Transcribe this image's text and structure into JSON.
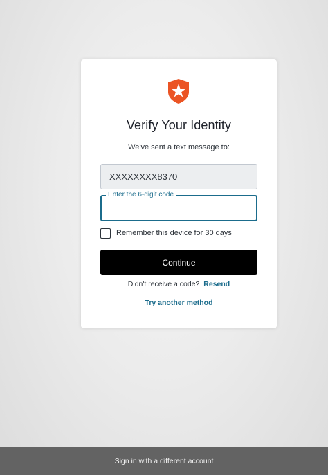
{
  "card": {
    "logo_icon": "auth0-shield-star-icon",
    "title": "Verify Your Identity",
    "subtitle": "We've sent a text message to:",
    "phone": "XXXXXXXX8370",
    "code_field": {
      "label": "Enter the 6-digit code",
      "value": ""
    },
    "remember_label": "Remember this device for 30 days",
    "continue_label": "Continue",
    "resend_prompt": "Didn't receive a code?",
    "resend_link": "Resend",
    "try_another": "Try another method"
  },
  "footer": {
    "label": "Sign in with a different account"
  },
  "colors": {
    "brand_logo": "#eb5424",
    "accent_link": "#1b6c8c",
    "primary_button": "#000000",
    "footer_bar": "#636363"
  }
}
